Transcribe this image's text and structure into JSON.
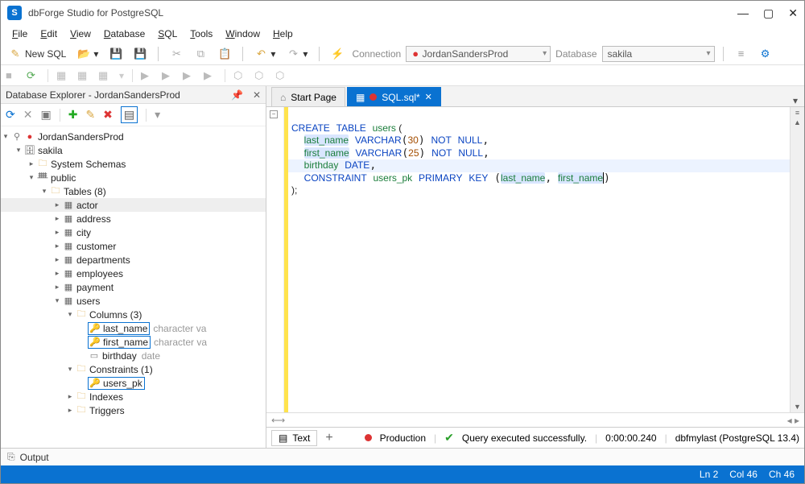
{
  "app": {
    "title": "dbForge Studio for PostgreSQL"
  },
  "menu": {
    "file": "File",
    "edit": "Edit",
    "view": "View",
    "database": "Database",
    "sql": "SQL",
    "tools": "Tools",
    "window": "Window",
    "help": "Help"
  },
  "toolbar": {
    "newsql_label": "New SQL",
    "connection_label": "Connection",
    "connection_value": "JordanSandersProd",
    "database_label": "Database",
    "database_value": "sakila"
  },
  "explorer": {
    "title": "Database Explorer - JordanSandersProd",
    "server": "JordanSandersProd",
    "database": "sakila",
    "schemas_folder": "System Schemas",
    "public_schema": "public",
    "tables_folder": "Tables (8)",
    "tables": [
      "actor",
      "address",
      "city",
      "customer",
      "departments",
      "employees",
      "payment",
      "users"
    ],
    "columns_folder": "Columns (3)",
    "columns": [
      {
        "name": "last_name",
        "type": "character va"
      },
      {
        "name": "first_name",
        "type": "character va"
      },
      {
        "name": "birthday",
        "type": "date"
      }
    ],
    "constraints_folder": "Constraints (1)",
    "constraint": "users_pk",
    "indexes_folder": "Indexes",
    "triggers_folder": "Triggers"
  },
  "tabs": {
    "start": "Start Page",
    "sql": "SQL.sql*"
  },
  "sql_tokens": {
    "l1a": "CREATE",
    "l1b": "TABLE",
    "l1c": "users",
    "l1d": " (",
    "l2a": "last_name",
    "l2b": "VARCHAR",
    "l2c": "30",
    "l2d": "NOT",
    "l2e": "NULL",
    "l3a": "first_name",
    "l3b": "VARCHAR",
    "l3c": "25",
    "l3d": "NOT",
    "l3e": "NULL",
    "l4a": "birthday",
    "l4b": "DATE",
    "l5a": "CONSTRAINT",
    "l5b": "users_pk",
    "l5c": "PRIMARY",
    "l5d": "KEY",
    "l5e": "last_name",
    "l5f": "first_name",
    "l6": ");"
  },
  "editor_footer": {
    "view_mode": "Text",
    "env_label": "Production",
    "status": "Query executed successfully.",
    "elapsed": "0:00:00.240",
    "server": "dbfmylast (PostgreSQL 13.4)"
  },
  "output_label": "Output",
  "statusbar": {
    "ln": "Ln 2",
    "col": "Col 46",
    "ch": "Ch 46"
  }
}
